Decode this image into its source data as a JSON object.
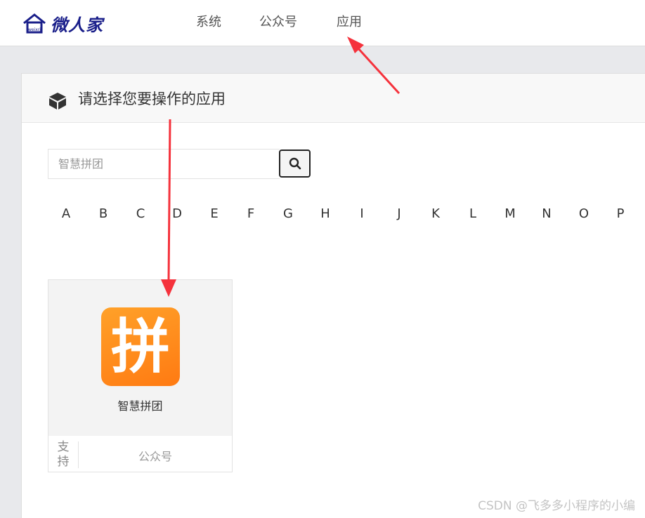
{
  "header": {
    "logo_text": "微人家",
    "logo_small_text": "weixrj",
    "nav": [
      {
        "label": "系统"
      },
      {
        "label": "公众号"
      },
      {
        "label": "应用"
      }
    ]
  },
  "panel": {
    "title": "请选择您要操作的应用",
    "title_icon": "cube-icon"
  },
  "search": {
    "placeholder": "智慧拼团",
    "button_icon": "search-icon"
  },
  "letters": [
    "A",
    "B",
    "C",
    "D",
    "E",
    "F",
    "G",
    "H",
    "I",
    "J",
    "K",
    "L",
    "M",
    "N",
    "O",
    "P"
  ],
  "apps": [
    {
      "name": "智慧拼团",
      "icon_glyph": "拼",
      "icon_color": "#ff8a1c",
      "support_label": "支持",
      "support_value": "公众号"
    }
  ],
  "annotation_arrow_color": "#f5323c",
  "watermark": "CSDN @飞多多小程序的小编"
}
